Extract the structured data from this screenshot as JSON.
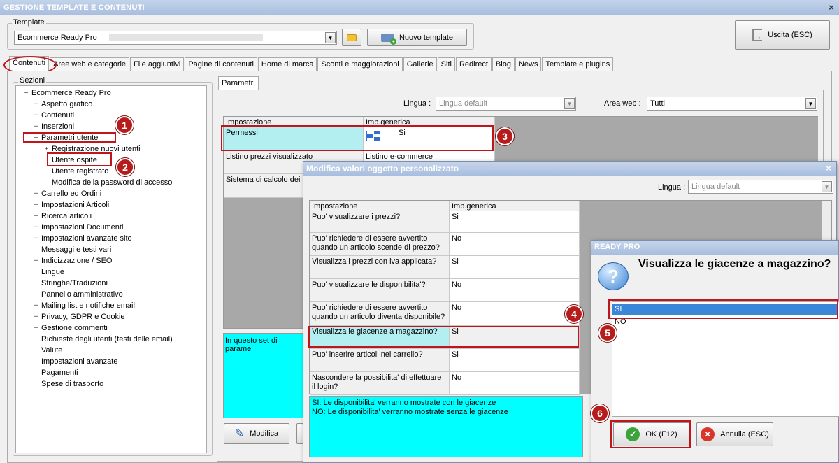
{
  "window": {
    "title": "GESTIONE TEMPLATE E CONTENUTI",
    "close": "×"
  },
  "template": {
    "group_label": "Template",
    "value": "Ecommerce Ready Pro",
    "new_button": "Nuovo template",
    "exit_button": "Uscita (ESC)"
  },
  "tabs": [
    "Contenuti",
    "Aree web e categorie",
    "File aggiuntivi",
    "Pagine di contenuti",
    "Home di marca",
    "Sconti e maggiorazioni",
    "Gallerie",
    "Siti",
    "Redirect",
    "Blog",
    "News",
    "Template e plugins"
  ],
  "sections": {
    "label": "Sezioni",
    "root": "Ecommerce Ready Pro",
    "items": [
      {
        "label": "Aspetto grafico",
        "exp": "+",
        "level": 1
      },
      {
        "label": "Contenuti",
        "exp": "+",
        "level": 1
      },
      {
        "label": "Inserzioni",
        "exp": "+",
        "level": 1
      },
      {
        "label": "Parametri utente",
        "exp": "−",
        "level": 1
      },
      {
        "label": "Registrazione nuovi utenti",
        "exp": "+",
        "level": 2
      },
      {
        "label": "Utente ospite",
        "exp": "",
        "level": 2
      },
      {
        "label": "Utente registrato",
        "exp": "",
        "level": 2
      },
      {
        "label": "Modifica della password di accesso",
        "exp": "",
        "level": 2
      },
      {
        "label": "Carrello ed Ordini",
        "exp": "+",
        "level": 1
      },
      {
        "label": "Impostazioni Articoli",
        "exp": "+",
        "level": 1
      },
      {
        "label": "Ricerca articoli",
        "exp": "+",
        "level": 1
      },
      {
        "label": "Impostazioni Documenti",
        "exp": "+",
        "level": 1
      },
      {
        "label": "Impostazioni avanzate sito",
        "exp": "+",
        "level": 1
      },
      {
        "label": "Messaggi e testi vari",
        "exp": "",
        "level": 1
      },
      {
        "label": "Indicizzazione / SEO",
        "exp": "+",
        "level": 1
      },
      {
        "label": "Lingue",
        "exp": "",
        "level": 1
      },
      {
        "label": "Stringhe/Traduzioni",
        "exp": "",
        "level": 1
      },
      {
        "label": "Pannello amministrativo",
        "exp": "",
        "level": 1
      },
      {
        "label": "Mailing list e notifiche email",
        "exp": "+",
        "level": 1
      },
      {
        "label": "Privacy, GDPR e Cookie",
        "exp": "+",
        "level": 1
      },
      {
        "label": "Gestione commenti",
        "exp": "+",
        "level": 1
      },
      {
        "label": "Richieste degli utenti (testi delle email)",
        "exp": "",
        "level": 1
      },
      {
        "label": "Valute",
        "exp": "",
        "level": 1
      },
      {
        "label": "Impostazioni avanzate",
        "exp": "",
        "level": 1
      },
      {
        "label": "Pagamenti",
        "exp": "",
        "level": 1
      },
      {
        "label": "Spese di trasporto",
        "exp": "",
        "level": 1
      }
    ]
  },
  "params": {
    "tab": "Parametri",
    "lingua_label": "Lingua :",
    "lingua_value": "Lingua default",
    "area_label": "Area web :",
    "area_value": "Tutti",
    "col1": "Impostazione",
    "col2": "Imp.generica",
    "rows": [
      {
        "name": "Permessi",
        "value": "Si"
      },
      {
        "name": "Listino prezzi visualizzato",
        "value": "Listino e-commerce"
      },
      {
        "name": "Sistema di calcolo dei pr",
        "value": ""
      }
    ],
    "desc": "In questo set di parame",
    "edit_button": "Modifica"
  },
  "custom_dialog": {
    "title": "Modifica valori oggetto personalizzato",
    "lingua_label": "Lingua :",
    "lingua_value": "Lingua default",
    "col1": "Impostazione",
    "col2": "Imp.generica",
    "rows": [
      {
        "name": "Puo' visualizzare i prezzi?",
        "value": "Si"
      },
      {
        "name": "Puo' richiedere di essere avvertito quando un articolo scende di prezzo?",
        "value": "No"
      },
      {
        "name": "Visualizza i prezzi con iva applicata?",
        "value": "Si"
      },
      {
        "name": "Puo' visualizzare le disponibilita'?",
        "value": "No"
      },
      {
        "name": "Puo' richiedere di essere avvertito quando un articolo diventa disponibile?",
        "value": "No"
      },
      {
        "name": "Visualizza le giacenze a magazzino?",
        "value": "Si"
      },
      {
        "name": "Puo' inserire articoli nel carrello?",
        "value": "Si"
      },
      {
        "name": "Nascondere la possibilita' di effettuare il login?",
        "value": "No"
      }
    ],
    "desc_line1": "SI: Le disponibilita' verranno mostrate con le giacenze",
    "desc_line2": "NO: Le disponibilita' verranno mostrate senza le giacenze"
  },
  "ready_dialog": {
    "title": "READY PRO",
    "question": "Visualizza le giacenze a magazzino?",
    "options": [
      "SI",
      "NO"
    ],
    "ok_button": "OK (F12)",
    "cancel_button": "Annulla (ESC)"
  },
  "callouts": [
    "1",
    "2",
    "3",
    "4",
    "5",
    "6"
  ],
  "colors": {
    "highlight": "#b3eef0",
    "cyan": "#00ffff",
    "selected": "#3a86d8",
    "callout": "#b71c1c"
  }
}
